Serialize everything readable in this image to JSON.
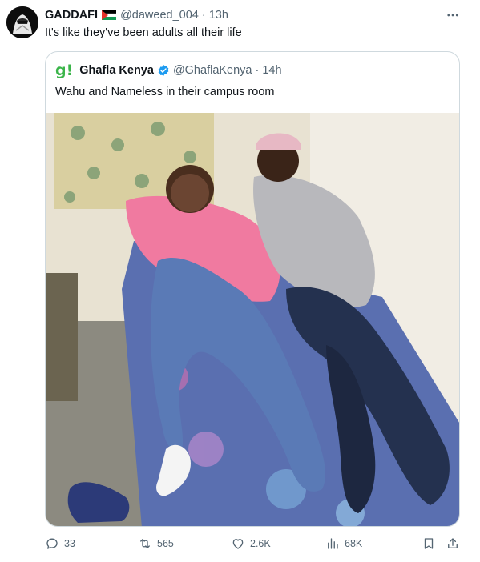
{
  "tweet": {
    "author_name": "GADDAFI",
    "handle": "@daweed_004",
    "separator": "·",
    "time": "13h",
    "text": "It's like they've been adults all their life",
    "more_icon": "more-icon"
  },
  "quoted": {
    "logo": "g!",
    "name": "Ghafla Kenya",
    "handle": "@GhaflaKenya",
    "separator": "·",
    "time": "14h",
    "text": "Wahu and Nameless in their campus room",
    "verified_color": "#1d9bf0"
  },
  "actions": {
    "replies": "33",
    "retweets": "565",
    "likes": "2.6K",
    "views": "68K"
  },
  "colors": {
    "text": "#0f1419",
    "secondary": "#536471",
    "border": "#cfd9de",
    "logo_green": "#3bb54a"
  }
}
